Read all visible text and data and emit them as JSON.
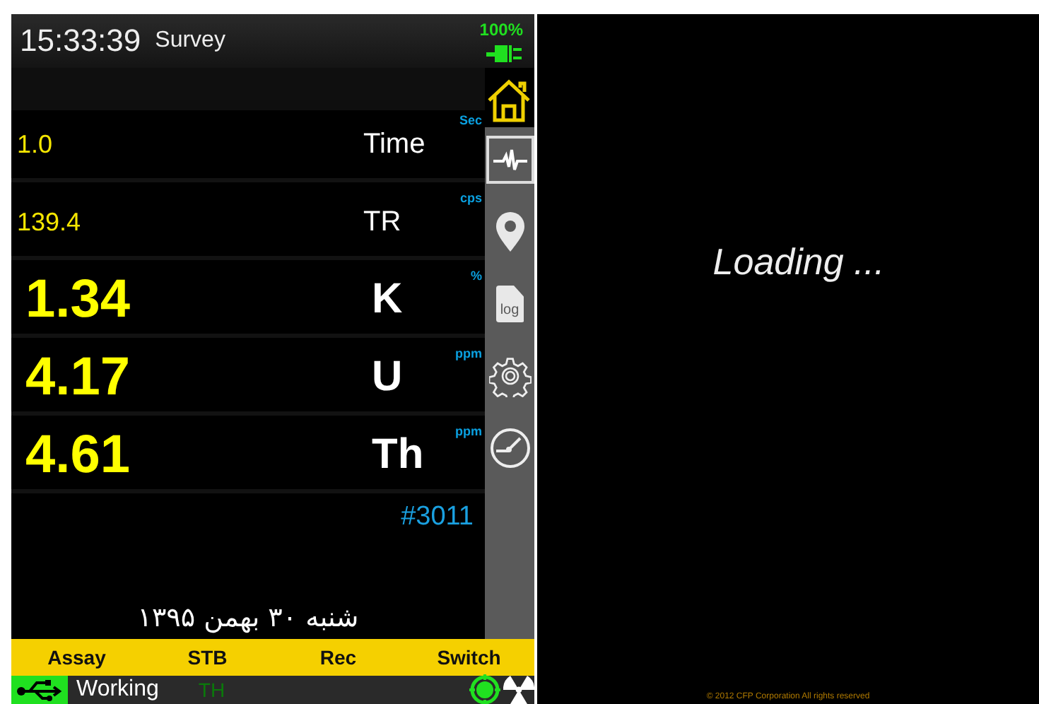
{
  "header": {
    "time": "15:33:39",
    "mode": "Survey",
    "battery": "100%"
  },
  "readings": [
    {
      "kind": "small",
      "value": "1.0",
      "label": "Time",
      "unit": "Sec"
    },
    {
      "kind": "small",
      "value": "139.4",
      "label": "TR",
      "unit": "cps"
    },
    {
      "kind": "large",
      "value": "1.34",
      "label": "K",
      "unit": "%"
    },
    {
      "kind": "large",
      "value": "4.17",
      "label": "U",
      "unit": "ppm"
    },
    {
      "kind": "large",
      "value": "4.61",
      "label": "Th",
      "unit": "ppm"
    }
  ],
  "record_number": "#3011",
  "date": "شنبه ۳۰ بهمن ۱۳۹۵",
  "nav": [
    {
      "kind": "pulse",
      "selected": true
    },
    {
      "kind": "location",
      "selected": false
    },
    {
      "kind": "log",
      "selected": false,
      "label": "log"
    },
    {
      "kind": "settings",
      "selected": false
    },
    {
      "kind": "gauge",
      "selected": false
    }
  ],
  "buttons": [
    "Assay",
    "STB",
    "Rec",
    "Switch"
  ],
  "status": {
    "text": "Working",
    "tag": "TH"
  },
  "splash": {
    "message": "Loading ...",
    "copyright": "© 2012 CFP Corporation All rights reserved"
  }
}
